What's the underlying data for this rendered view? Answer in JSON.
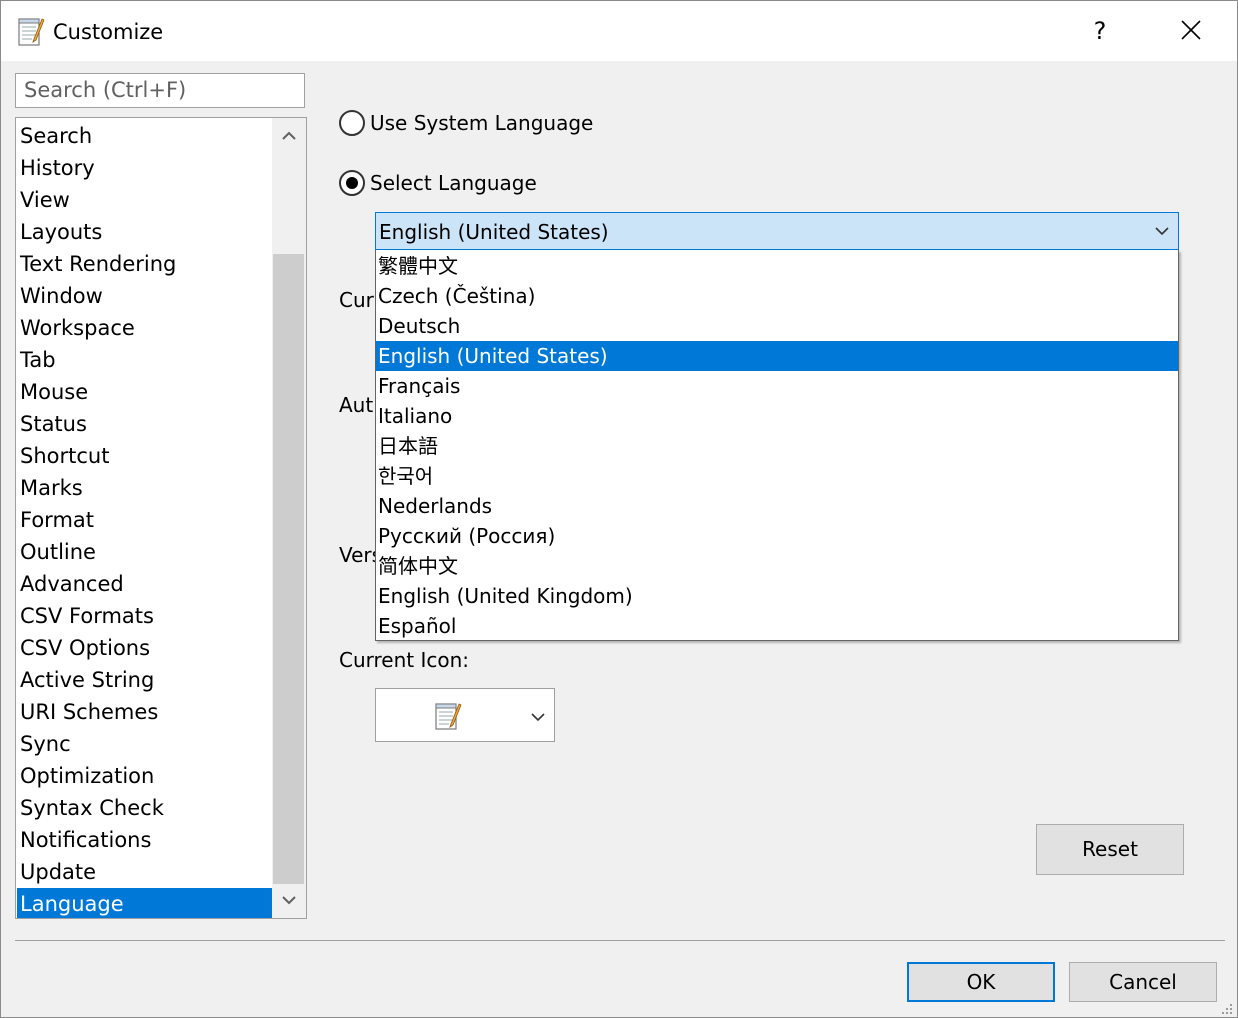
{
  "window": {
    "title": "Customize",
    "help_label": "?",
    "icons": {
      "app": "notepad-icon",
      "close": "close-icon"
    }
  },
  "search": {
    "placeholder": "Search (Ctrl+F)"
  },
  "categories": {
    "items": [
      "Search",
      "History",
      "View",
      "Layouts",
      "Text Rendering",
      "Window",
      "Workspace",
      "Tab",
      "Mouse",
      "Status",
      "Shortcut",
      "Marks",
      "Format",
      "Outline",
      "Advanced",
      "CSV Formats",
      "CSV Options",
      "Active String",
      "URI Schemes",
      "Sync",
      "Optimization",
      "Syntax Check",
      "Notifications",
      "Update",
      "Language"
    ],
    "selected": "Language"
  },
  "language": {
    "use_system_label": "Use System Language",
    "select_label": "Select Language",
    "selected_value": "English (United States)",
    "partially_hidden_labels": [
      "Curr",
      "Autl",
      "Vers"
    ],
    "options": [
      "繁體中文",
      "Czech (Čeština)",
      "Deutsch",
      "English (United States)",
      "Français",
      "Italiano",
      "日本語",
      "한국어",
      "Nederlands",
      "Русский (Россия)",
      "简体中文",
      "English (United Kingdom)",
      "Español"
    ],
    "current_icon_label": "Current Icon:"
  },
  "buttons": {
    "reset": "Reset",
    "ok": "OK",
    "cancel": "Cancel"
  },
  "colors": {
    "accent": "#0078d7",
    "combo_highlight": "#cce4f7",
    "dialog_bg": "#f0f0f0"
  }
}
